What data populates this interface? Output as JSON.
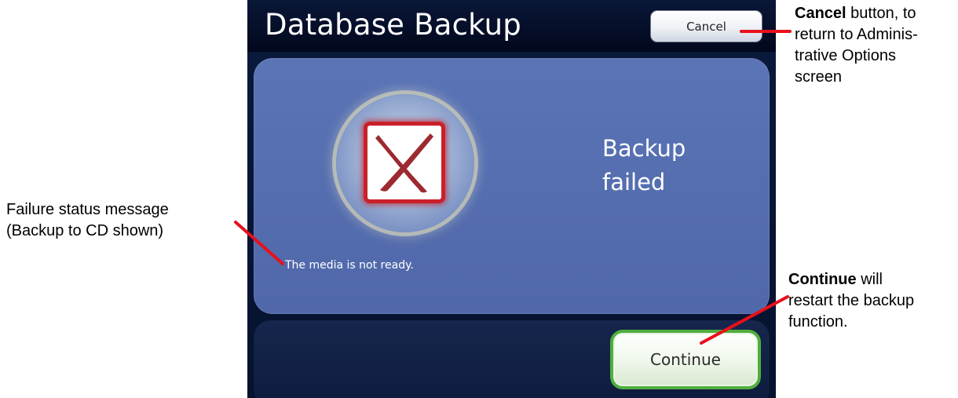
{
  "screen": {
    "title": "Database Backup",
    "cancel_label": "Cancel",
    "status_heading_line1": "Backup",
    "status_heading_line2": "failed",
    "status_message": "The media is not ready.",
    "continue_label": "Continue",
    "status_icon": "x-mark-icon"
  },
  "annotations": {
    "failure": {
      "line1": "Failure status message",
      "line2": "(Backup to CD shown)"
    },
    "cancel": {
      "bold": "Cancel",
      "text1": " button, to",
      "line2": "return to Adminis-",
      "line3": "trative Options",
      "line4": "screen"
    },
    "continue": {
      "bold": "Continue",
      "text1": " will",
      "line2": "restart the backup",
      "line3": "function."
    }
  },
  "colors": {
    "callout_line": "#e8101a",
    "panel_blue": "#5a74b6",
    "title_bar": "#02081c",
    "failure_red": "#c9202a",
    "continue_border": "#4fae3e"
  }
}
